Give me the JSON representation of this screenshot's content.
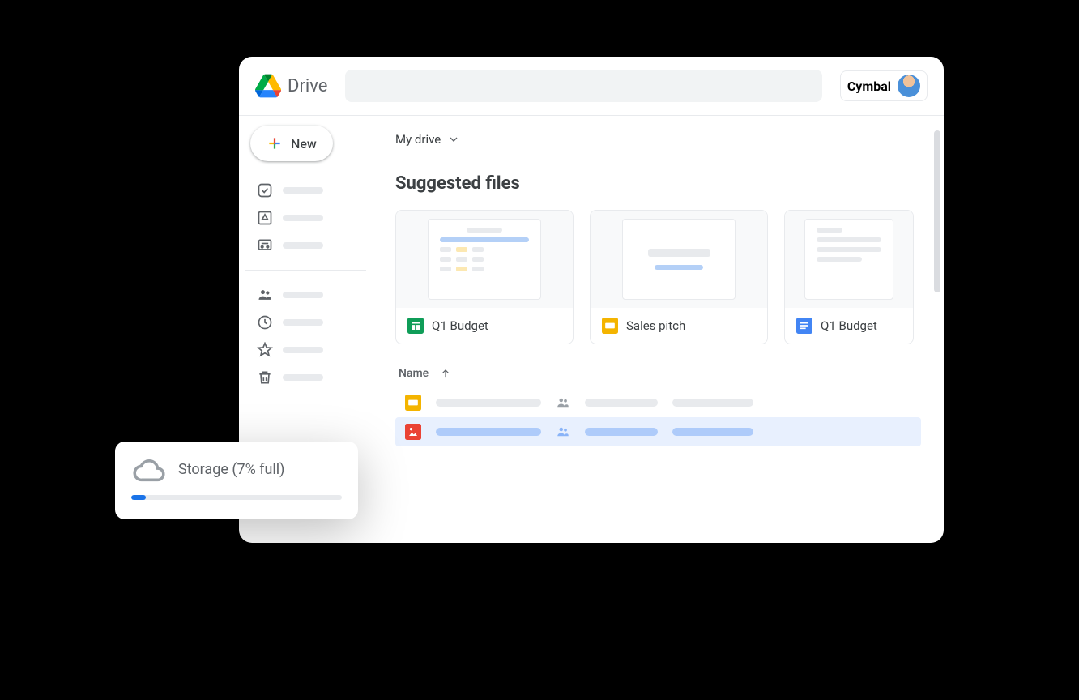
{
  "app": {
    "title": "Drive",
    "org_name": "Cymbal"
  },
  "sidebar": {
    "new_label": "New"
  },
  "breadcrumb": {
    "label": "My drive"
  },
  "section": {
    "title": "Suggested files"
  },
  "cards": [
    {
      "name": "Q1 Budget",
      "type": "sheets"
    },
    {
      "name": "Sales pitch",
      "type": "slides"
    },
    {
      "name": "Q1 Budget",
      "type": "docs"
    }
  ],
  "table": {
    "header_name": "Name",
    "rows": [
      {
        "type": "slides",
        "selected": false
      },
      {
        "type": "image",
        "selected": true
      }
    ]
  },
  "storage": {
    "label": "Storage (7% full)",
    "percent": 7
  }
}
